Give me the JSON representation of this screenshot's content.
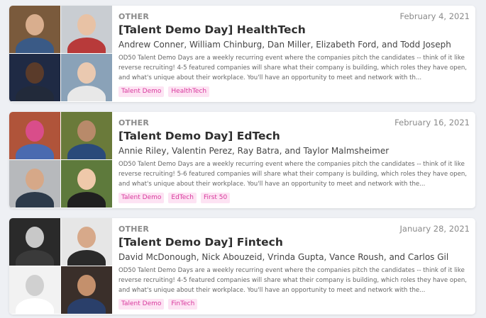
{
  "events": [
    {
      "category": "OTHER",
      "date": "February 4, 2021",
      "title": "[Talent Demo Day] HealthTech",
      "speakers": "Andrew Conner, William Chinburg, Dan Miller, Elizabeth Ford, and Todd Joseph",
      "description": "OD50 Talent Demo Days are a weekly recurring event where the companies pitch the candidates -- think of it like reverse recruiting! 4-5 featured companies will share what their company is building, which roles they have open, and what's unique about their workplace. You'll have an opportunity to meet and network with th...",
      "tags": [
        "Talent Demo",
        "HealthTech"
      ],
      "photos": [
        {
          "bg": "#7a5a3c",
          "skin": "#d9ae8e",
          "shirt": "#3a5a86"
        },
        {
          "bg": "#c9cdd2",
          "skin": "#e8c2a5",
          "shirt": "#b83a3a"
        },
        {
          "bg": "#1f2a44",
          "skin": "#5a3b2a",
          "shirt": "#222a3a"
        },
        {
          "bg": "#8aa2b8",
          "skin": "#eac9b0",
          "shirt": "#e8e8e8"
        }
      ]
    },
    {
      "category": "OTHER",
      "date": "February 16, 2021",
      "title": "[Talent Demo Day] EdTech",
      "speakers": "Annie Riley, Valentin Perez, Ray Batra, and Taylor Malmsheimer",
      "description": "OD50 Talent Demo Days are a weekly recurring event where the companies pitch the candidates -- think of it like reverse recruiting! 5-6 featured companies will share what their company is building, which roles they have open, and what's unique about their workplace. You'll have an opportunity to meet and network with the...",
      "tags": [
        "Talent Demo",
        "EdTech",
        "First 50"
      ],
      "photos": [
        {
          "bg": "#b0543a",
          "skin": "#d94d8a",
          "shirt": "#4a6ab0"
        },
        {
          "bg": "#6a7a3a",
          "skin": "#b88a6a",
          "shirt": "#2a4a7a"
        },
        {
          "bg": "#b7b9bc",
          "skin": "#d6a888",
          "shirt": "#2d3a4a"
        },
        {
          "bg": "#5e7a3c",
          "skin": "#efc9aa",
          "shirt": "#1f1f1f"
        }
      ]
    },
    {
      "category": "OTHER",
      "date": "January 28, 2021",
      "title": "[Talent Demo Day] Fintech",
      "speakers": "David McDonough, Nick Abouzeid, Vrinda Gupta, Vance Roush, and Carlos Gil",
      "description": "OD50 Talent Demo Days are a weekly recurring event where the companies pitch the candidates -- think of it like reverse recruiting! 4-5 featured companies will share what their company is building, which roles they have open, and what's unique about their workplace. You'll have an opportunity to meet and network with the...",
      "tags": [
        "Talent Demo",
        "FinTech"
      ],
      "photos": [
        {
          "bg": "#2a2a2a",
          "skin": "#c8c8c8",
          "shirt": "#3a3a3a"
        },
        {
          "bg": "#e6e6e6",
          "skin": "#d7a98a",
          "shirt": "#2a2a2a"
        },
        {
          "bg": "#f2f2f2",
          "skin": "#d0d0d0",
          "shirt": "#ffffff"
        },
        {
          "bg": "#3a2f2a",
          "skin": "#c4906c",
          "shirt": "#2a3f6a"
        }
      ]
    }
  ]
}
